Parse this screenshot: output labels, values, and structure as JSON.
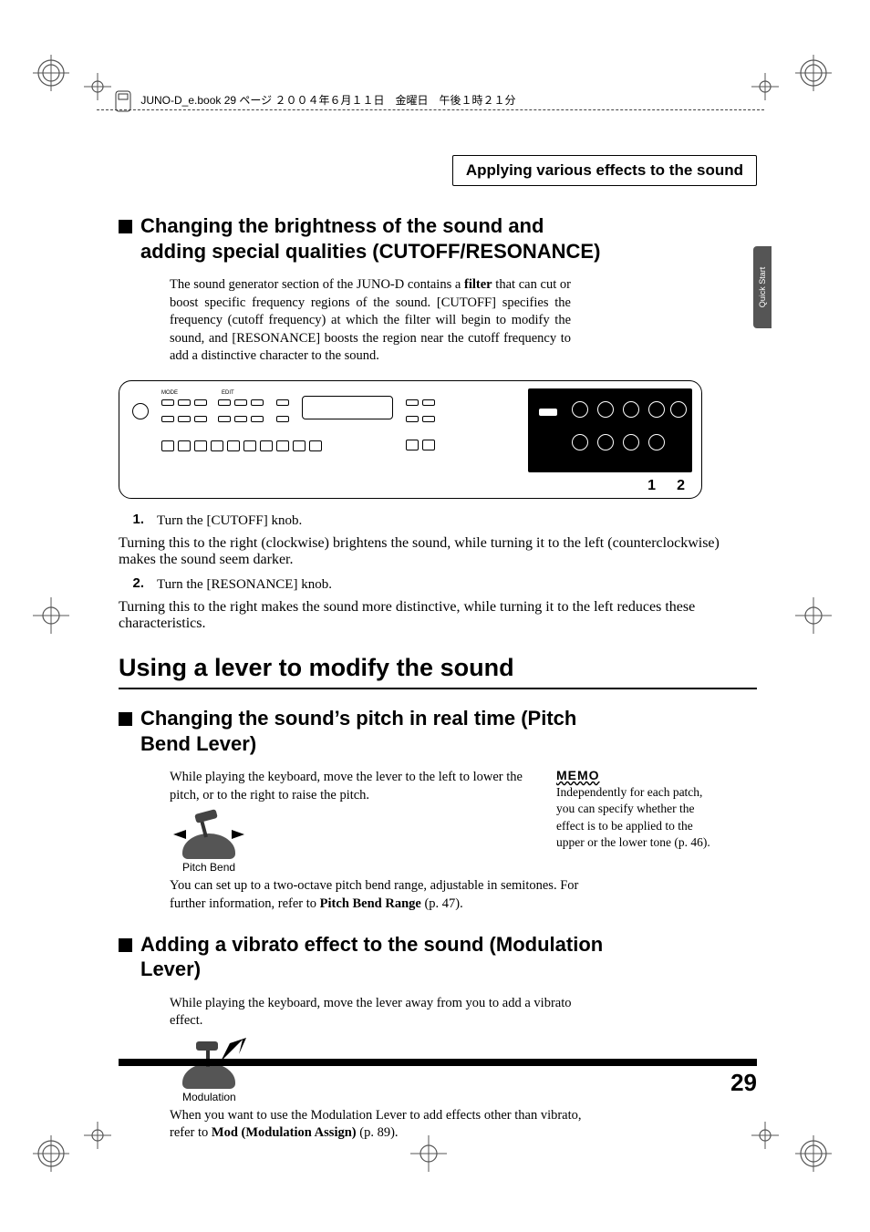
{
  "header": {
    "bookline": "JUNO-D_e.book  29 ページ  ２００４年６月１１日　金曜日　午後１時２１分"
  },
  "sectionTab": "Applying various effects to the sound",
  "sideTab": "Quick Start",
  "h2_cutoff": "Changing the brightness of the sound and adding special qualities (CUTOFF/RESONANCE)",
  "intro": {
    "pre": "The sound generator section of the JUNO-D contains a ",
    "bold1": "filter",
    "post": " that can cut or boost specific frequency regions of the sound. [CUTOFF] specifies the frequency (cutoff frequency) at which the filter will begin to modify the sound, and [RESONANCE] boosts the region near the cutoff frequency to add a distinctive character to the sound."
  },
  "panelCallouts": {
    "one": "1",
    "two": "2"
  },
  "step1_num": "1.",
  "step1": "Turn the [CUTOFF] knob.",
  "step1_desc": "Turning this to the right (clockwise) brightens the sound, while turning it to the left (counterclockwise) makes the sound seem darker.",
  "step2_num": "2.",
  "step2": "Turn the [RESONANCE] knob.",
  "step2_desc": "Turning this to the right makes the sound more distinctive, while turning it to the left reduces these characteristics.",
  "h1_lever": "Using a lever to modify the sound",
  "h2_pitch": "Changing the sound’s pitch in real time (Pitch Bend Lever)",
  "pitch_para": "While playing the keyboard, move the lever to the left to lower the pitch, or to the right to raise the pitch.",
  "pitch_caption": "Pitch Bend",
  "pitch_para2_pre": "You can set up to a two-octave pitch bend range, adjustable in semitones. For further information, refer to ",
  "pitch_para2_bold": "Pitch Bend Range",
  "pitch_para2_post": " (p. 47).",
  "memo_label": "MEMO",
  "memo_text": "Independently for each patch, you can specify whether the effect is to be applied to the upper or the lower tone (p. 46).",
  "h2_mod": "Adding a vibrato effect to the sound (Modulation Lever)",
  "mod_para": "While playing the keyboard, move the lever away from you to add a vibrato effect.",
  "mod_caption": "Modulation",
  "mod_para2_pre": "When you want to use the Modulation Lever to add effects other than vibrato, refer to ",
  "mod_para2_bold": "Mod (Modulation Assign)",
  "mod_para2_post": " (p. 89).",
  "pageNo": "29"
}
